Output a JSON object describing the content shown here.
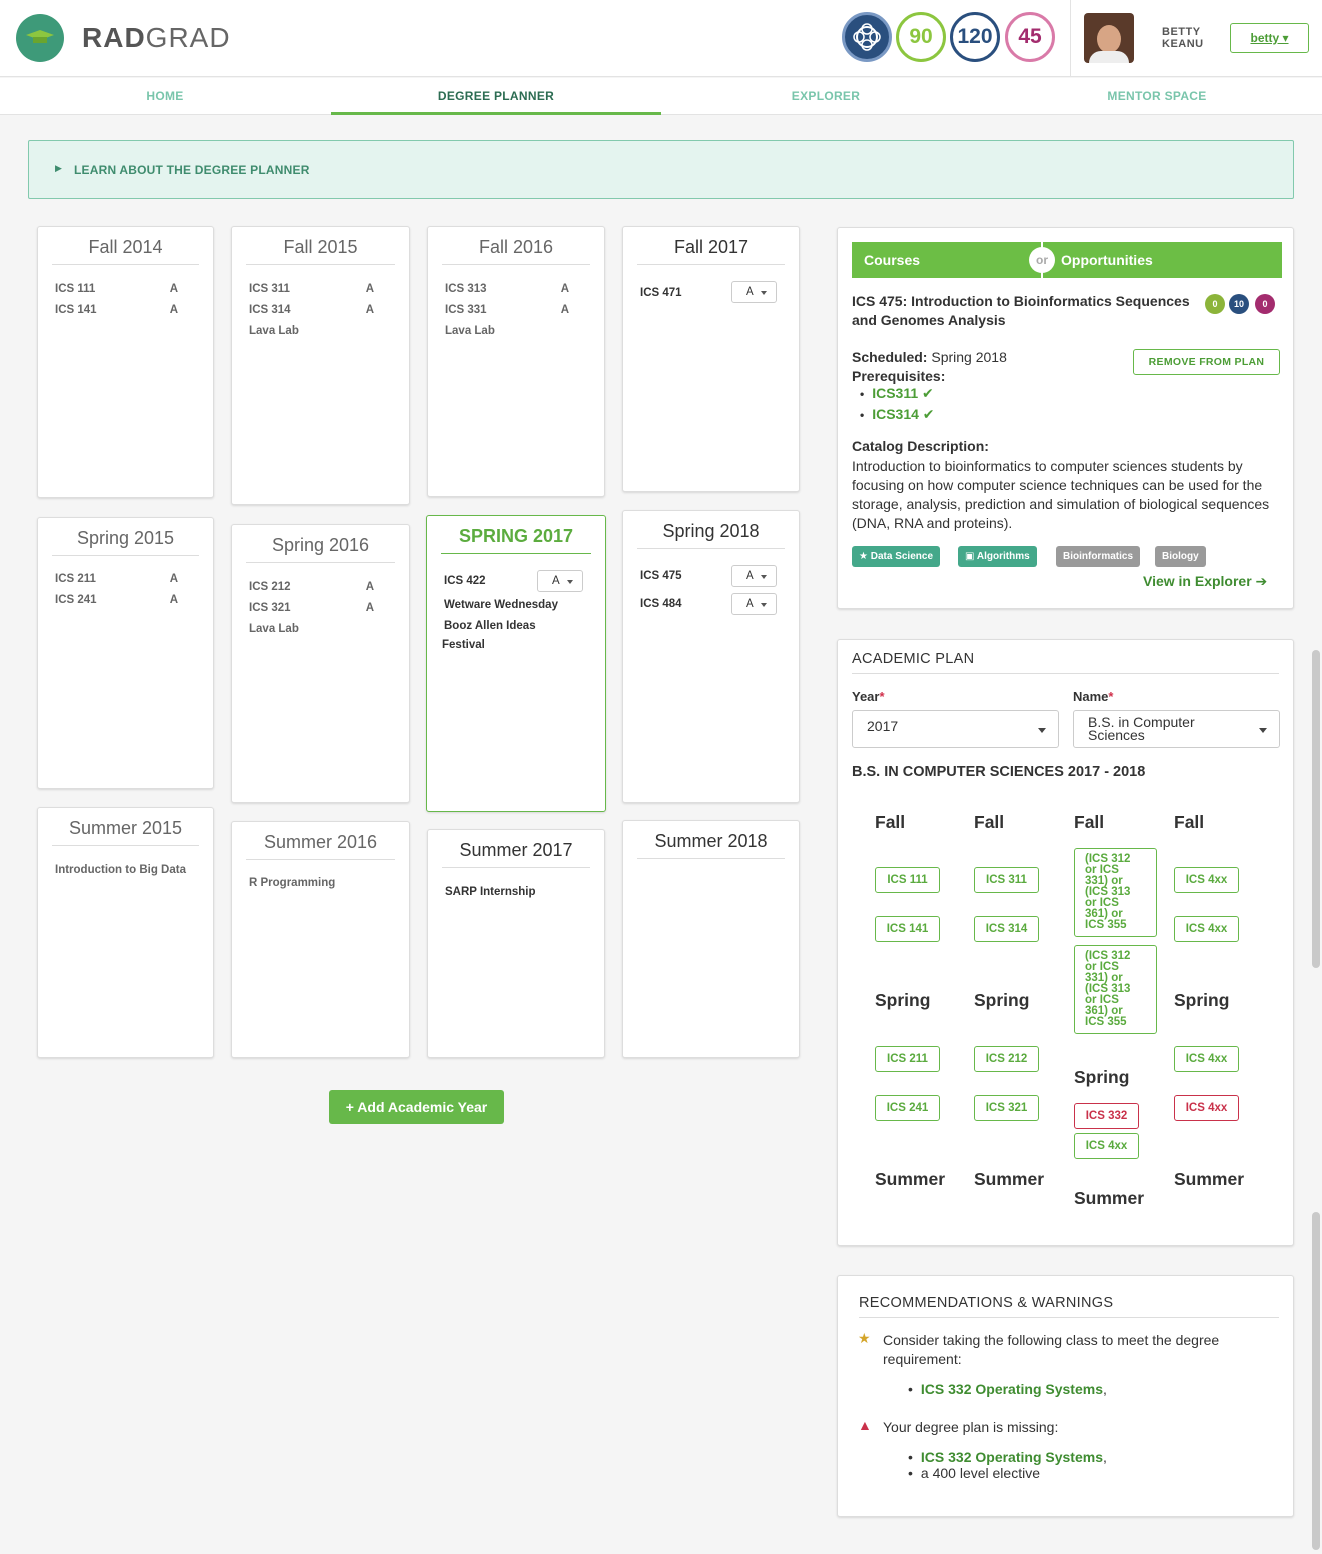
{
  "header": {
    "brand_bold": "RAD",
    "brand_light": "GRAD",
    "points": [
      {
        "value": "90",
        "color": "#8cc63f"
      },
      {
        "value": "120",
        "color": "#2a4f7e"
      },
      {
        "value": "45",
        "color": "#a32c6e"
      }
    ],
    "user_first": "BETTY",
    "user_last": "KEANU",
    "user_button": "betty ▾"
  },
  "nav": {
    "tabs": [
      "HOME",
      "DEGREE PLANNER",
      "EXPLORER",
      "MENTOR SPACE"
    ],
    "active": "DEGREE PLANNER"
  },
  "learn": {
    "label": "LEARN ABOUT THE DEGREE PLANNER"
  },
  "semesters": {
    "fall2014": {
      "title": "Fall 2014",
      "items": [
        {
          "name": "ICS 111",
          "grade": "A"
        },
        {
          "name": "ICS 141",
          "grade": "A"
        }
      ]
    },
    "fall2015": {
      "title": "Fall 2015",
      "items": [
        {
          "name": "ICS 311",
          "grade": "A"
        },
        {
          "name": "ICS 314",
          "grade": "A"
        },
        {
          "name": "Lava Lab"
        }
      ]
    },
    "fall2016": {
      "title": "Fall 2016",
      "items": [
        {
          "name": "ICS 313",
          "grade": "A"
        },
        {
          "name": "ICS 331",
          "grade": "A"
        },
        {
          "name": "Lava Lab"
        }
      ]
    },
    "fall2017": {
      "title": "Fall 2017",
      "items": [
        {
          "name": "ICS 471",
          "grade": "A"
        }
      ]
    },
    "spring2015": {
      "title": "Spring 2015",
      "items": [
        {
          "name": "ICS 211",
          "grade": "A"
        },
        {
          "name": "ICS 241",
          "grade": "A"
        }
      ]
    },
    "spring2016": {
      "title": "Spring 2016",
      "items": [
        {
          "name": "ICS 212",
          "grade": "A"
        },
        {
          "name": "ICS 321",
          "grade": "A"
        },
        {
          "name": "Lava Lab"
        }
      ]
    },
    "spring2017": {
      "title": "SPRING 2017",
      "items": [
        {
          "name": "ICS 422",
          "grade": "A"
        },
        {
          "name": "Wetware Wednesday"
        },
        {
          "name": "Booz Allen Ideas"
        },
        {
          "name": "Festival"
        }
      ]
    },
    "spring2018": {
      "title": "Spring 2018",
      "items": [
        {
          "name": "ICS 475",
          "grade": "A"
        },
        {
          "name": "ICS 484",
          "grade": "A"
        }
      ]
    },
    "summer2015": {
      "title": "Summer 2015",
      "items": [
        {
          "name": "Introduction to Big Data"
        }
      ]
    },
    "summer2016": {
      "title": "Summer 2016",
      "items": [
        {
          "name": "R Programming"
        }
      ]
    },
    "summer2017": {
      "title": "Summer 2017",
      "items": [
        {
          "name": "SARP Internship"
        }
      ]
    },
    "summer2018": {
      "title": "Summer 2018",
      "items": []
    }
  },
  "add_year": "+ Add Academic Year",
  "details": {
    "tab_courses": "Courses",
    "tab_or": "or",
    "tab_opps": "Opportunities",
    "title_line1": "ICS 475: Introduction to Bioinformatics Sequences",
    "title_line2": "and Genomes Analysis",
    "mini": [
      {
        "value": "0",
        "color": "#8cb43a"
      },
      {
        "value": "10",
        "color": "#2a4f7e"
      },
      {
        "value": "0",
        "color": "#a32c6e"
      }
    ],
    "scheduled_label": "Scheduled:",
    "scheduled_value": "Spring 2018",
    "remove_label": "REMOVE FROM PLAN",
    "prereq_label": "Prerequisites:",
    "prereqs": [
      "ICS311",
      "ICS314"
    ],
    "catalog_label": "Catalog Description:",
    "catalog_text": "Introduction to bioinformatics to computer sciences students by focusing on how computer science techniques can be used for the storage, analysis, prediction and simulation of biological sequences (DNA, RNA and proteins).",
    "tags": [
      "Data Science",
      "Algorithms",
      "Bioinformatics",
      "Biology"
    ],
    "view_explorer": "View in Explorer ➔"
  },
  "academic_plan": {
    "heading": "ACADEMIC PLAN",
    "year_label": "Year",
    "year_value": "2017",
    "name_label": "Name",
    "name_value_1": "B.S. in Computer",
    "name_value_2": "Sciences",
    "plan_title": "B.S. IN COMPUTER SCIENCES 2017 - 2018",
    "fall": "Fall",
    "spring": "Spring",
    "summer": "Summer",
    "col1_fall": [
      "ICS 111",
      "ICS 141"
    ],
    "col1_spring": [
      "ICS 211",
      "ICS 241"
    ],
    "col2_fall": [
      "ICS 311",
      "ICS 314"
    ],
    "col2_spring": [
      "ICS 212",
      "ICS 321"
    ],
    "col3_fall": [
      [
        "(ICS 312",
        "or ICS",
        "331) or",
        "(ICS 313",
        "or ICS",
        "361) or",
        "ICS 355"
      ],
      [
        "(ICS 312",
        "or ICS",
        "331) or",
        "(ICS 313",
        "or ICS",
        "361) or",
        "ICS 355"
      ]
    ],
    "col3_spring": [
      "ICS 332",
      "ICS 4xx"
    ],
    "col4_fall": [
      "ICS 4xx",
      "ICS 4xx"
    ],
    "col4_spring": [
      "ICS 4xx",
      "ICS 4xx"
    ]
  },
  "recommendations": {
    "heading": "RECOMMENDATIONS & WARNINGS",
    "consider_1": "Consider taking the following class to meet the degree",
    "consider_2": "requirement:",
    "consider_item": "ICS 332 Operating Systems",
    "missing": "Your degree plan is missing:",
    "missing_item_1": "ICS 332 Operating Systems",
    "missing_item_2": "a 400 level elective"
  }
}
